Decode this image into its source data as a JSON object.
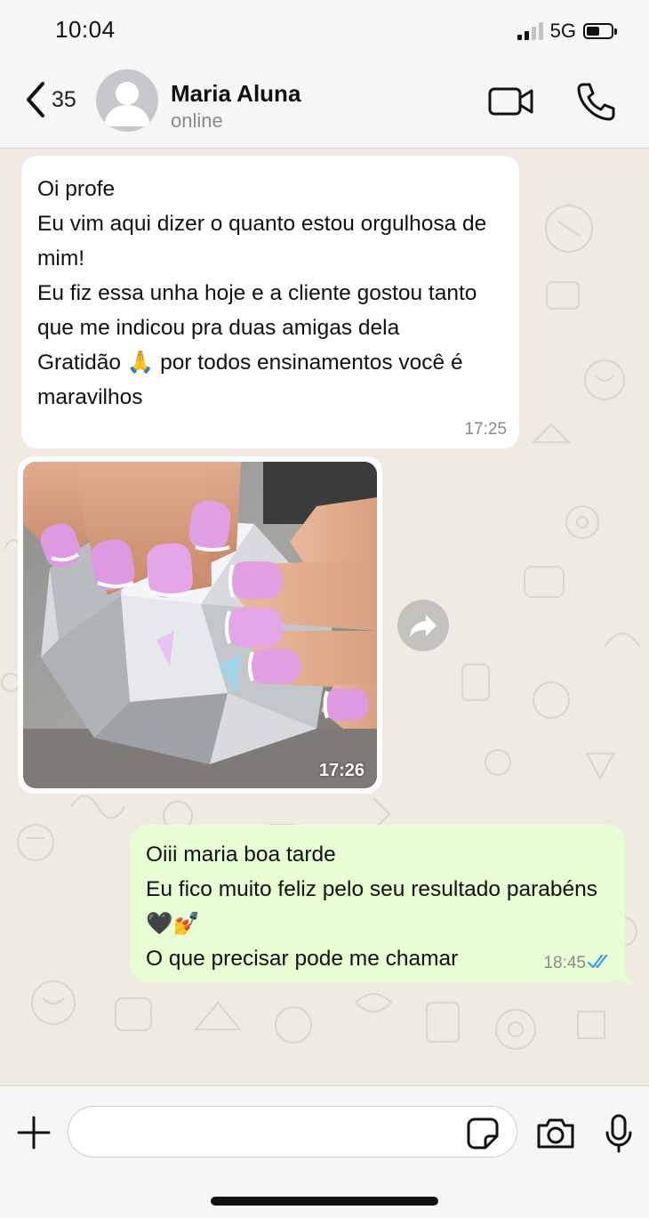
{
  "status_bar": {
    "time": "10:04",
    "network": "5G",
    "signal_bars_filled": 2,
    "signal_bars_total": 4,
    "battery_level": 0.45
  },
  "header": {
    "back_icon": "chevron-left-icon",
    "unread_count": "35",
    "contact_name": "Maria Aluna",
    "contact_status": "online",
    "video_icon": "video-camera-icon",
    "call_icon": "phone-icon"
  },
  "messages": [
    {
      "direction": "incoming",
      "text": "Oi profe\nEu vim aqui dizer o quanto estou orgulhosa de mim!\nEu fiz essa unha hoje e a cliente gostou tanto que me indicou pra duas amigas dela\nGratidão 🙏 por todos ensinamentos você é maravilhos",
      "time": "17:25"
    },
    {
      "direction": "incoming",
      "type": "image",
      "image_subject": "hands with pink manicured nails resting on a large crystal diamond",
      "time": "17:26",
      "forward_icon": "forward-arrow-icon"
    },
    {
      "direction": "outgoing",
      "text": "Oiii maria boa tarde\nEu fico muito feliz pelo seu resultado parabéns 🖤💅\nO que precisar pode me chamar",
      "time": "18:45",
      "read_status_icon": "double-check-icon"
    }
  ],
  "composer": {
    "placeholder": "",
    "plus_icon": "plus-icon",
    "sticker_icon": "sticker-icon",
    "camera_icon": "camera-icon",
    "mic_icon": "microphone-icon"
  },
  "colors": {
    "chat_background": "#efeae2",
    "incoming_bubble": "#ffffff",
    "outgoing_bubble": "#e7fdd3",
    "read_tick": "#3b9bf1",
    "bar_background": "#f6f6f6"
  }
}
